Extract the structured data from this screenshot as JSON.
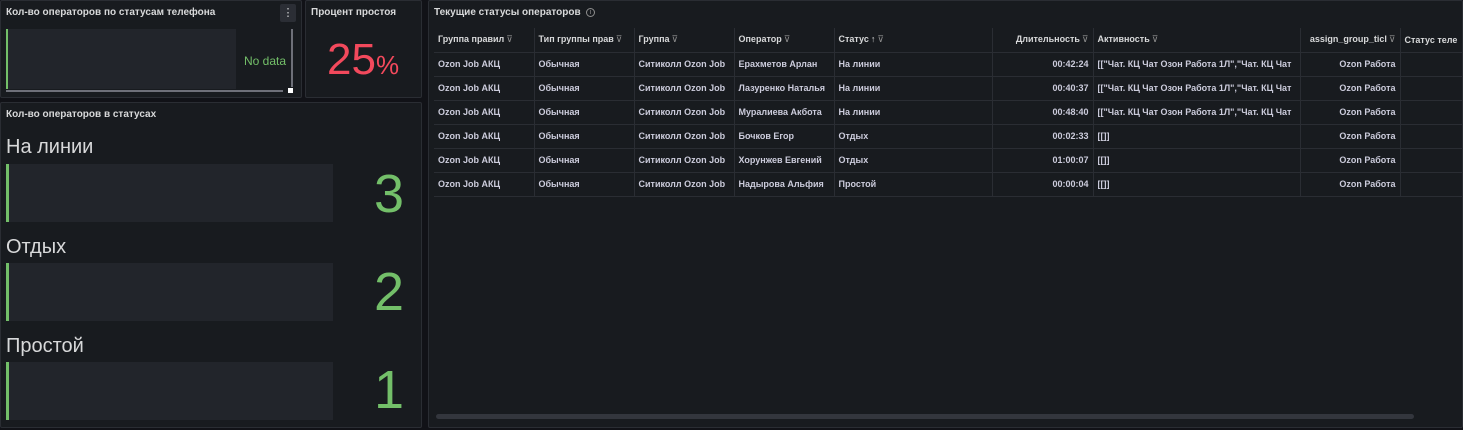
{
  "phone_status_panel": {
    "title": "Кол-во операторов по статусам телефона",
    "menu_glyph": "⋮",
    "no_data": "No data"
  },
  "idle_panel": {
    "title": "Процент простоя",
    "value": "25",
    "unit": "%"
  },
  "status_counts_panel": {
    "title": "Кол-во операторов в статусах",
    "items": [
      {
        "label": "На линии",
        "value": "3"
      },
      {
        "label": "Отдых",
        "value": "2"
      },
      {
        "label": "Простой",
        "value": "1"
      }
    ]
  },
  "operators_table": {
    "title": "Текущие статусы операторов",
    "info_glyph": "i",
    "filter_glyph": "⊽",
    "sort_glyph": "↑",
    "columns": [
      "Группа правил",
      "Тип группы прав",
      "Группа",
      "Оператор",
      "Статус",
      "Длительность",
      "Активность",
      "assign_group_ticl",
      "Статус теле"
    ],
    "rows": [
      [
        "Ozon Job АКЦ",
        "Обычная",
        "Ситиколл Ozon Job",
        "Ерахметов Арлан",
        "На линии",
        "00:42:24",
        "[[\"Чат. КЦ Чат Озон Работа 1Л\",\"Чат. КЦ Чат",
        "Ozon Работа",
        ""
      ],
      [
        "Ozon Job АКЦ",
        "Обычная",
        "Ситиколл Ozon Job",
        "Лазуренко Наталья",
        "На линии",
        "00:40:37",
        "[[\"Чат. КЦ Чат Озон Работа 1Л\",\"Чат. КЦ Чат",
        "Ozon Работа",
        ""
      ],
      [
        "Ozon Job АКЦ",
        "Обычная",
        "Ситиколл Ozon Job",
        "Муралиева Акбота",
        "На линии",
        "00:48:40",
        "[[\"Чат. КЦ Чат Озон Работа 1Л\",\"Чат. КЦ Чат",
        "Ozon Работа",
        ""
      ],
      [
        "Ozon Job АКЦ",
        "Обычная",
        "Ситиколл Ozon Job",
        "Бочков Егор",
        "Отдых",
        "00:02:33",
        "[[]]",
        "Ozon Работа",
        ""
      ],
      [
        "Ozon Job АКЦ",
        "Обычная",
        "Ситиколл Ozon Job",
        "Хорунжев Евгений",
        "Отдых",
        "01:00:07",
        "[[]]",
        "Ozon Работа",
        ""
      ],
      [
        "Ozon Job АКЦ",
        "Обычная",
        "Ситиколл Ozon Job",
        "Надырова Альфия",
        "Простой",
        "00:00:04",
        "[[]]",
        "Ozon Работа",
        ""
      ]
    ]
  }
}
